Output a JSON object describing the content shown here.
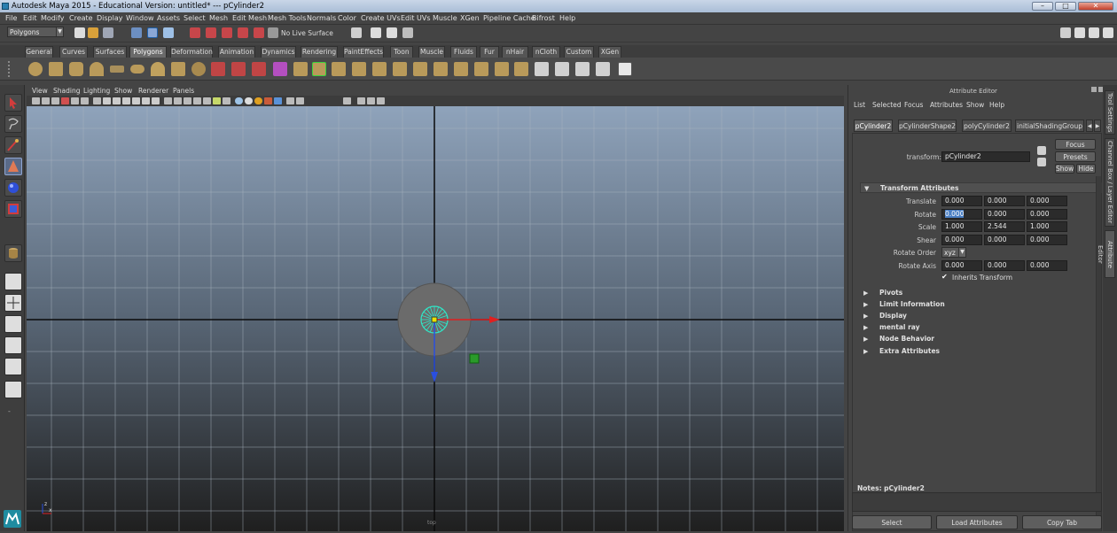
{
  "window": {
    "title": "Autodesk Maya 2015 - Educational Version: untitled*    ---    pCylinder2",
    "minimize": "–",
    "maximize": "□",
    "close": "✕"
  },
  "menubar": [
    "File",
    "Edit",
    "Modify",
    "Create",
    "Display",
    "Window",
    "Assets",
    "Select",
    "Mesh",
    "Edit Mesh",
    "Mesh Tools",
    "Normals",
    "Color",
    "Create UVs",
    "Edit UVs",
    "Muscle",
    "XGen",
    "Pipeline Cache",
    "Bifrost",
    "Help"
  ],
  "statusline": {
    "menu_set": "Polygons",
    "live_surface": "No Live Surface"
  },
  "shelf": {
    "tabs": [
      "General",
      "Curves",
      "Surfaces",
      "Polygons",
      "Deformation",
      "Animation",
      "Dynamics",
      "Rendering",
      "PaintEffects",
      "Toon",
      "Muscle",
      "Fluids",
      "Fur",
      "nHair",
      "nCloth",
      "Custom",
      "XGen"
    ],
    "active_tab": "Polygons"
  },
  "viewport": {
    "menu": [
      "View",
      "Shading",
      "Lighting",
      "Show",
      "Renderer",
      "Panels"
    ],
    "camera_label": "top",
    "axis_x": "x",
    "axis_z": "z"
  },
  "attribute_editor": {
    "title": "Attribute Editor",
    "menu": [
      "List",
      "Selected",
      "Focus",
      "Attributes",
      "Show",
      "Help"
    ],
    "tabs": [
      "pCylinder2",
      "pCylinderShape2",
      "polyCylinder2",
      "initialShadingGroup"
    ],
    "active_tab": "pCylinder2",
    "focus_button": "Focus",
    "presets_button": "Presets",
    "show_button": "Show",
    "hide_button": "Hide",
    "node_type_label": "transform:",
    "node_name": "pCylinder2",
    "transform_section": "Transform Attributes",
    "rows": [
      {
        "label": "Translate",
        "values": [
          "0.000",
          "0.000",
          "0.000"
        ]
      },
      {
        "label": "Rotate",
        "values": [
          "0.000",
          "0.000",
          "0.000"
        ]
      },
      {
        "label": "Scale",
        "values": [
          "1.000",
          "2.544",
          "1.000"
        ]
      },
      {
        "label": "Shear",
        "values": [
          "0.000",
          "0.000",
          "0.000"
        ]
      }
    ],
    "rotate_order_label": "Rotate Order",
    "rotate_order_value": "xyz",
    "rotate_axis_label": "Rotate Axis",
    "rotate_axis_values": [
      "0.000",
      "0.000",
      "0.000"
    ],
    "inherits_transform_label": "Inherits Transform",
    "inherits_transform_checked": true,
    "collapsed_sections": [
      "Pivots",
      "Limit Information",
      "Display",
      "mental ray",
      "Node Behavior",
      "Extra Attributes"
    ],
    "notes_label": "Notes:  pCylinder2",
    "bottom_buttons": [
      "Select",
      "Load Attributes",
      "Copy Tab"
    ]
  },
  "side_tabs": [
    "Tool Settings",
    "Channel Box / Layer Editor",
    "Attribute Editor"
  ],
  "colors": {
    "viewport_top": "#8fa3bb",
    "viewport_bottom": "#1f1f1f",
    "grid_line": "#a9b3bf",
    "cylinder_fill": "#6b6b6b",
    "wireframe": "#2ee8c8",
    "manip_x": "#e02020",
    "manip_z": "#2a4fe0"
  }
}
